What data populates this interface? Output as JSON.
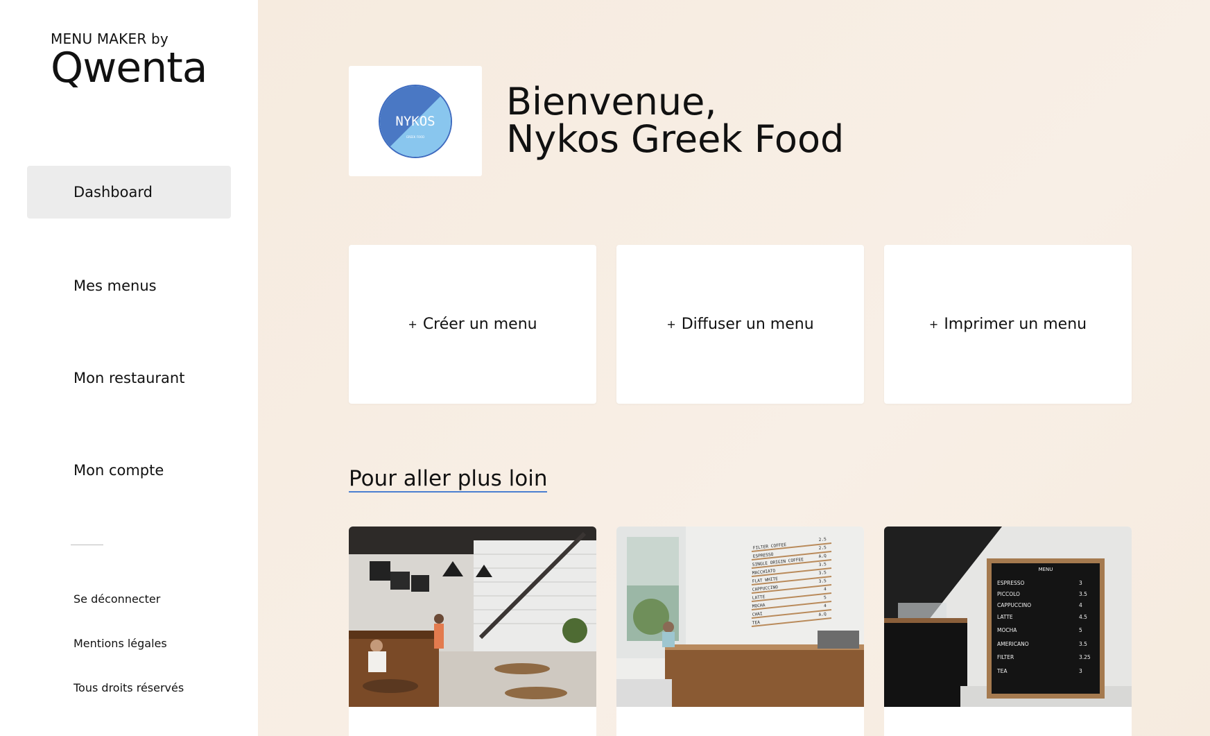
{
  "brand": {
    "tagline": "MENU MAKER by",
    "logo_text": "Qwenta"
  },
  "sidebar": {
    "items": [
      {
        "label": "Dashboard",
        "active": true
      },
      {
        "label": "Mes menus",
        "active": false
      },
      {
        "label": "Mon restaurant",
        "active": false
      },
      {
        "label": "Mon compte",
        "active": false
      }
    ],
    "footer": [
      {
        "label": "Se déconnecter"
      },
      {
        "label": "Mentions légales"
      },
      {
        "label": "Tous droits réservés"
      }
    ]
  },
  "header": {
    "greeting": "Bienvenue,",
    "restaurant_name": "Nykos Greek Food",
    "logo_text": "NYKOS",
    "logo_subtext": "GREEK FOOD"
  },
  "actions": [
    {
      "plus": "+",
      "label": "Créer un menu"
    },
    {
      "plus": "+",
      "label": "Diffuser un menu"
    },
    {
      "plus": "+",
      "label": "Imprimer un menu"
    }
  ],
  "section": {
    "title": "Pour aller plus loin"
  },
  "menu_board_wall": {
    "items": [
      "FILTER COFFEE",
      "ESPRESSO",
      "SINGLE ORIGIN COFFEE",
      "MACCHIATO",
      "FLAT WHITE",
      "CAPPUCCINO",
      "LATTE",
      "MOCHA",
      "CHAI",
      "TEA"
    ],
    "prices": [
      "2.5",
      "2.5",
      "A.Q",
      "3.5",
      "3.5",
      "3.5",
      "4",
      "5",
      "4",
      "A.Q"
    ]
  },
  "menu_board": {
    "title": "MENU",
    "items": [
      {
        "name": "ESPRESSO",
        "price": "3"
      },
      {
        "name": "PICCOLO",
        "price": "3.5"
      },
      {
        "name": "CAPPUCCINO",
        "price": "4"
      },
      {
        "name": "LATTE",
        "price": "4.5"
      },
      {
        "name": "MOCHA",
        "price": "5"
      },
      {
        "name": "AMERICANO",
        "price": "3.5"
      },
      {
        "name": "FILTER",
        "price": "3.25"
      },
      {
        "name": "TEA",
        "price": "3"
      }
    ]
  },
  "colors": {
    "background": "#f6ebdf",
    "accent": "#4a7fd0",
    "active_nav": "#ececec"
  }
}
